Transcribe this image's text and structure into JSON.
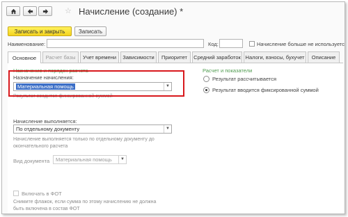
{
  "nav": {
    "home_icon": "home-icon",
    "back_icon": "arrow-left-icon",
    "forward_icon": "arrow-right-icon",
    "favorite_icon": "star-icon"
  },
  "window": {
    "title": "Начисление (создание) *"
  },
  "toolbar": {
    "save_close_label": "Записать и закрыть",
    "save_label": "Записать"
  },
  "header": {
    "name_label": "Наименование:",
    "name_value": "",
    "code_label": "Код:",
    "code_value": "",
    "unused_label": "Начисление больше не используется"
  },
  "tabs": [
    {
      "label": "Основное",
      "state": "active"
    },
    {
      "label": "Расчет базы",
      "state": "disabled"
    },
    {
      "label": "Учет времени",
      "state": "normal"
    },
    {
      "label": "Зависимости",
      "state": "normal"
    },
    {
      "label": "Приоритет",
      "state": "normal"
    },
    {
      "label": "Средний заработок",
      "state": "normal"
    },
    {
      "label": "Налоги, взносы, бухучет",
      "state": "normal"
    },
    {
      "label": "Описание",
      "state": "normal"
    }
  ],
  "left": {
    "section_title": "Назначение и порядок расчета",
    "purpose_label": "Назначение начисления:",
    "purpose_value": "Материальная помощь",
    "purpose_hint": "Результат вводится фиксированной суммой",
    "performed_label": "Начисление выполняется:",
    "performed_value": "По отдельному документу",
    "performed_hint_line1": "Начисление выполняется только по отдельному документу до",
    "performed_hint_line2": "окончательного расчета",
    "doc_type_label": "Вид документа",
    "doc_type_value": "Материальная помощь",
    "fot_label": "Включать в ФОТ",
    "fot_hint_line1": "Снимите флажок, если сумма по этому начислению не должна",
    "fot_hint_line2": "быть включена в состав ФОТ"
  },
  "right": {
    "section_title": "Расчет и показатели",
    "option_calculated": "Результат рассчитывается",
    "option_fixed": "Результат вводится фиксированной суммой",
    "selected": "fixed"
  },
  "colors": {
    "highlight": "#d8181c",
    "primary_button": "#f4d21d",
    "section_title": "#4e9a4e",
    "selection": "#3c6fc7"
  }
}
